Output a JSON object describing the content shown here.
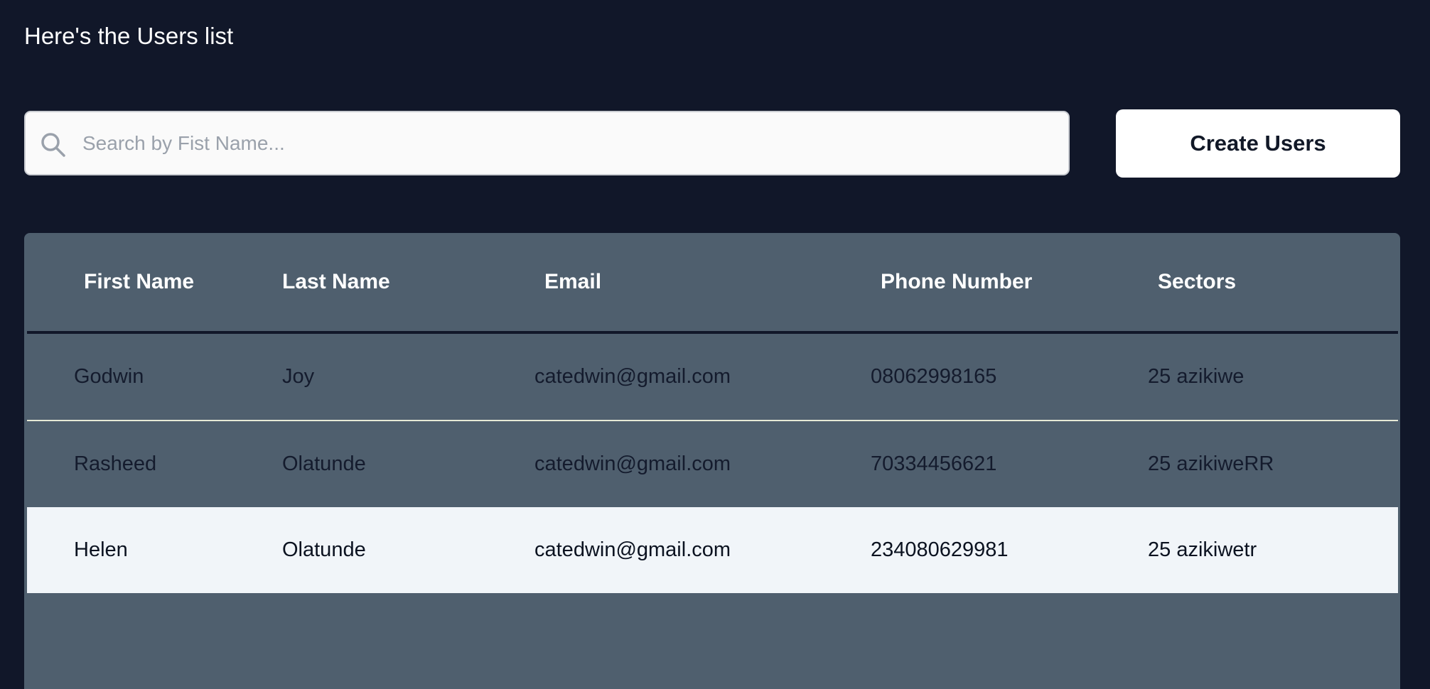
{
  "page": {
    "title": "Here's the Users list"
  },
  "search": {
    "placeholder": "Search by Fist Name...",
    "value": "",
    "icon": "search-icon"
  },
  "actions": {
    "create_users_label": "Create Users"
  },
  "table": {
    "columns": [
      "First Name",
      "Last Name",
      "Email",
      "Phone Number",
      "Sectors"
    ],
    "rows": [
      {
        "first_name": "Godwin",
        "last_name": "Joy",
        "email": "catedwin@gmail.com",
        "phone": "08062998165",
        "sector": "25 azikiwe"
      },
      {
        "first_name": "Rasheed",
        "last_name": "Olatunde",
        "email": "catedwin@gmail.com",
        "phone": "70334456621",
        "sector": "25 azikiweRR"
      },
      {
        "first_name": "Helen",
        "last_name": "Olatunde",
        "email": "catedwin@gmail.com",
        "phone": "234080629981",
        "sector": "25 azikiwetr"
      }
    ]
  },
  "colors": {
    "background": "#111729",
    "table_panel": "#4f5f6e",
    "highlight_row": "#f1f5f9",
    "button": "#ffffff",
    "search_field": "#fafafa"
  }
}
